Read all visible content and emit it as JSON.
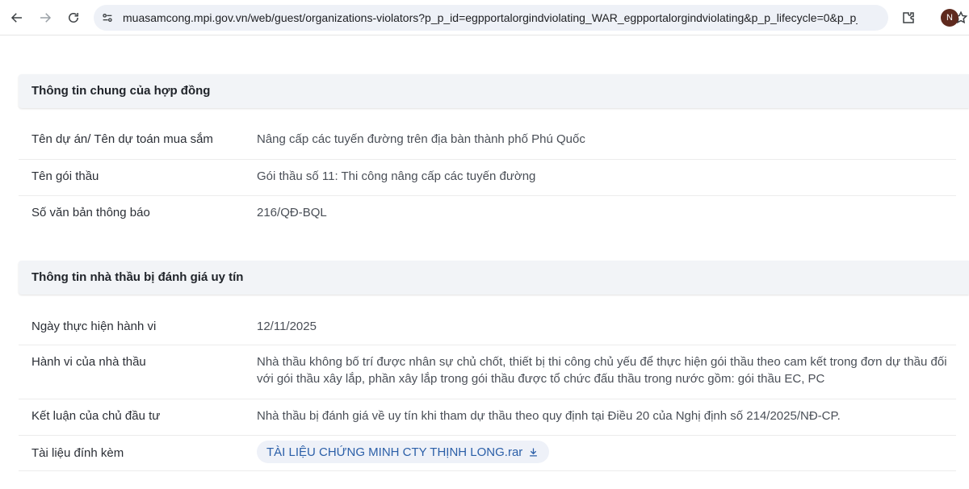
{
  "browser": {
    "url": "muasamcong.mpi.gov.vn/web/guest/organizations-violators?p_p_id=egpportalorgindviolating_WAR_egpportalorgindviolating&p_p_lifecycle=0&p_p_s...",
    "profile_initial": "N"
  },
  "section_contract": {
    "title": "Thông tin chung của hợp đồng",
    "rows": [
      {
        "label": "Tên dự án/ Tên dự toán mua sắm",
        "value": "Nâng cấp các tuyến đường trên địa bàn thành phố Phú Quốc"
      },
      {
        "label": "Tên gói thầu",
        "value": "Gói thầu số 11: Thi công nâng cấp các tuyến đường"
      },
      {
        "label": "Số văn bản thông báo",
        "value": "216/QĐ-BQL"
      }
    ]
  },
  "section_contractor": {
    "title": "Thông tin nhà thầu bị đánh giá uy tín",
    "rows": [
      {
        "label": "Ngày thực hiện hành vi",
        "value": "12/11/2025"
      },
      {
        "label": "Hành vi của nhà thầu",
        "value": "Nhà thầu không bố trí được nhân sự chủ chốt, thiết bị thi công chủ yếu để thực hiện gói thầu theo cam kết trong đơn dự thầu đối với gói thầu xây lắp, phần xây lắp trong gói thầu được tổ chức đấu thầu trong nước gồm: gói thầu EC, PC"
      },
      {
        "label": "Kết luận của chủ đầu tư",
        "value": "Nhà thầu bị đánh giá về uy tín khi tham dự thầu theo quy định tại Điều 20 của Nghị định số 214/2025/NĐ-CP."
      },
      {
        "label": "Tài liệu đính kèm",
        "value": "TÀI LIỆU CHỨNG MINH CTY THỊNH LONG.rar"
      }
    ]
  }
}
